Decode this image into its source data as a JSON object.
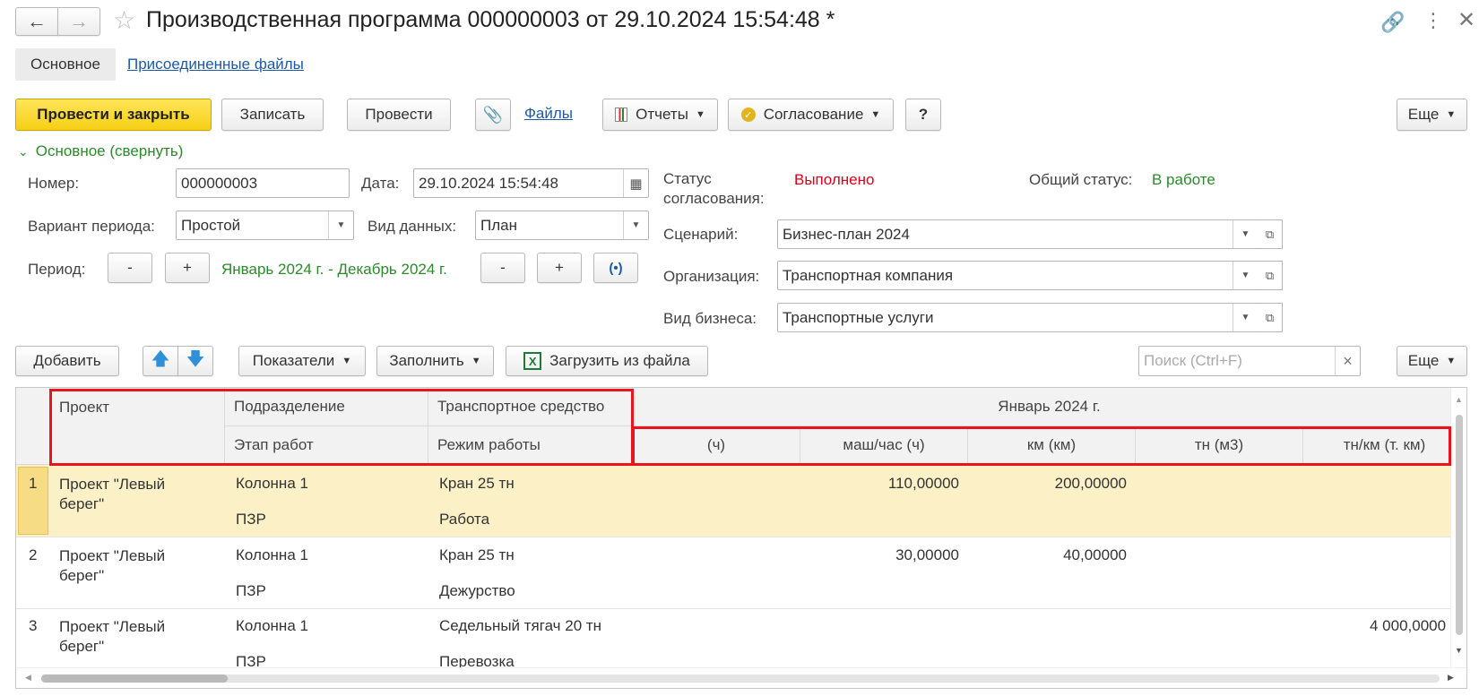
{
  "title": "Производственная программа 000000003 от 29.10.2024 15:54:48 *",
  "tabs": [
    {
      "label": "Основное",
      "active": true
    },
    {
      "label": "Присоединенные файлы",
      "active": false
    }
  ],
  "toolbar": {
    "post_close": "Провести и закрыть",
    "write": "Записать",
    "post": "Провести",
    "files": "Файлы",
    "reports": "Отчеты",
    "approval": "Согласование",
    "help": "?",
    "more": "Еще"
  },
  "section": {
    "collapse_label": "Основное (свернуть)"
  },
  "form": {
    "number_label": "Номер:",
    "number_value": "000000003",
    "date_label": "Дата:",
    "date_value": "29.10.2024 15:54:48",
    "status_label_1": "Статус",
    "status_label_2": "согласования:",
    "status_value": "Выполнено",
    "overall_label": "Общий статус:",
    "overall_value": "В работе",
    "period_variant_label": "Вариант периода:",
    "period_variant_value": "Простой",
    "data_kind_label": "Вид данных:",
    "data_kind_value": "План",
    "scenario_label": "Сценарий:",
    "scenario_value": "Бизнес-план 2024",
    "org_label": "Организация:",
    "org_value": "Транспортная компания",
    "business_label": "Вид бизнеса:",
    "business_value": "Транспортные услуги",
    "period_label": "Период:",
    "period_minus": "-",
    "period_plus": "+",
    "period_value": "Январь 2024 г. - Декабрь 2024 г."
  },
  "table_toolbar": {
    "add": "Добавить",
    "indicators": "Показатели",
    "fill": "Заполнить",
    "load": "Загрузить из файла",
    "search_placeholder": "Поиск (Ctrl+F)",
    "clear": "×",
    "more": "Еще"
  },
  "table": {
    "headers": {
      "project": "Проект",
      "division": "Подразделение",
      "vehicle": "Транспортное средство",
      "stage": "Этап работ",
      "mode": "Режим работы",
      "month": "Январь 2024 г.",
      "col_h": "(ч)",
      "col_machh": "маш/час (ч)",
      "col_km": "км (км)",
      "col_tn": "тн (м3)",
      "col_tnkm": "тн/км (т. км)"
    },
    "rows": [
      {
        "n": "1",
        "project1": "Проект \"Левый",
        "project2": "берег\"",
        "division": "Колонна 1",
        "stage": "ПЗР",
        "vehicle": "Кран 25 тн",
        "mode": "Работа",
        "h": "",
        "machh": "110,00000",
        "km": "200,00000",
        "tn": "",
        "tnkm": ""
      },
      {
        "n": "2",
        "project1": "Проект \"Левый",
        "project2": "берег\"",
        "division": "Колонна 1",
        "stage": "ПЗР",
        "vehicle": "Кран 25 тн",
        "mode": "Дежурство",
        "h": "",
        "machh": "30,00000",
        "km": "40,00000",
        "tn": "",
        "tnkm": ""
      },
      {
        "n": "3",
        "project1": "Проект \"Левый",
        "project2": "берег\"",
        "division": "Колонна 1",
        "stage": "ПЗР",
        "vehicle": "Седельный тягач 20 тн",
        "mode": "Перевозка",
        "h": "",
        "machh": "",
        "km": "",
        "tn": "",
        "tnkm": "4 000,0000"
      }
    ]
  }
}
